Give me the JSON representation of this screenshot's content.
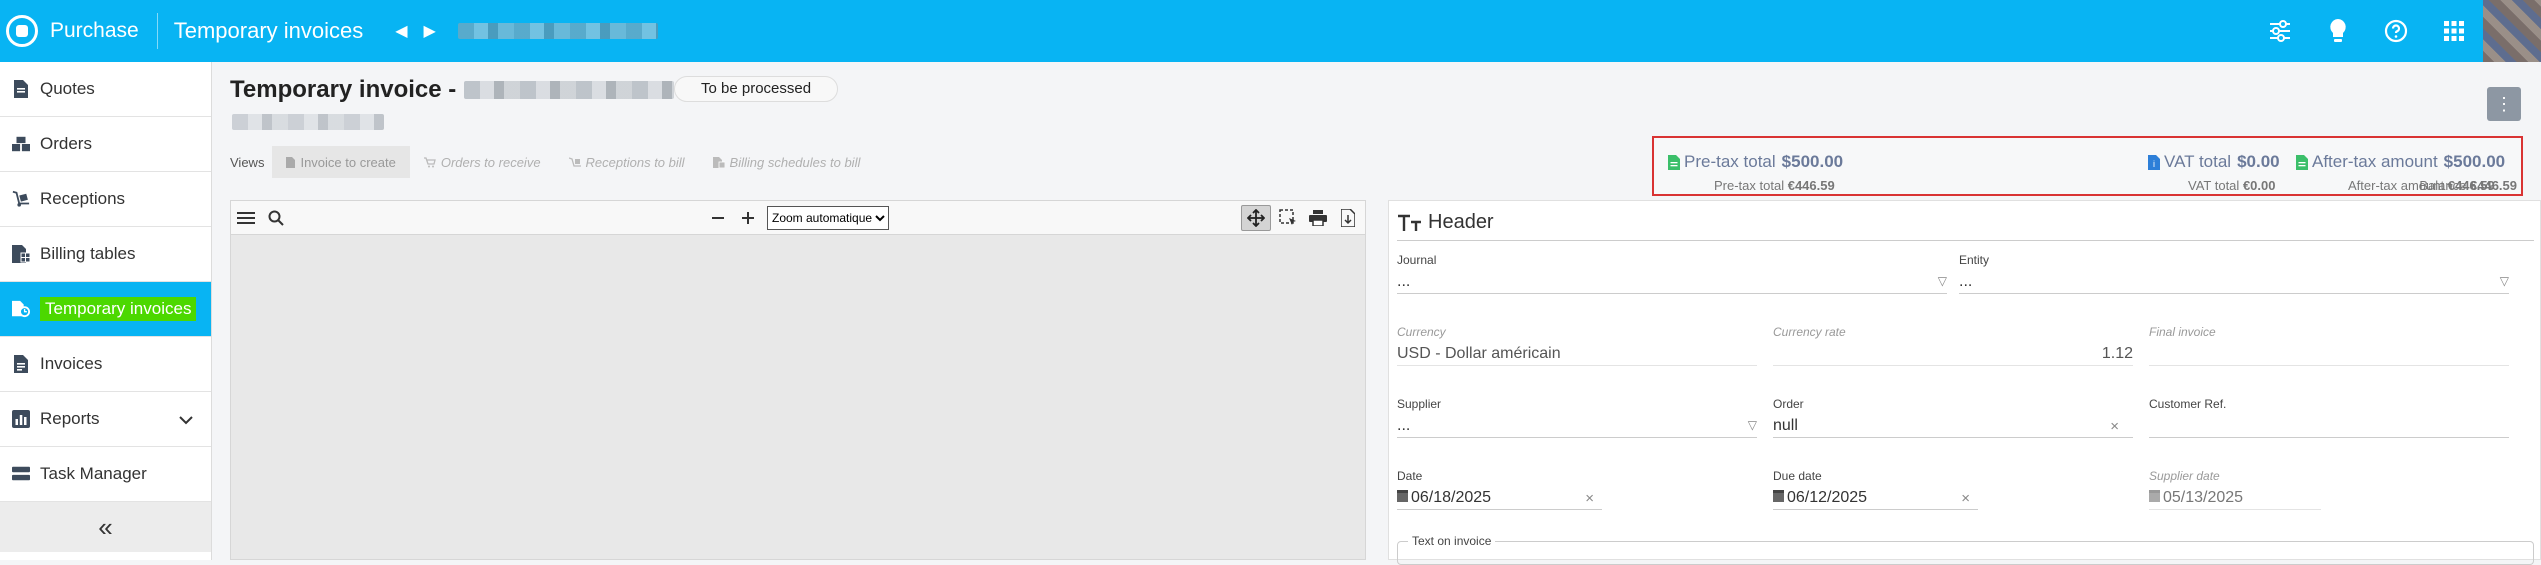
{
  "app": {
    "title": "Purchase",
    "module": "Temporary invoices"
  },
  "sidebar": {
    "items": [
      {
        "label": "Quotes",
        "icon": "quote-doc-icon"
      },
      {
        "label": "Orders",
        "icon": "orders-boxes-icon"
      },
      {
        "label": "Receptions",
        "icon": "dolly-icon"
      },
      {
        "label": "Billing tables",
        "icon": "billing-table-icon"
      },
      {
        "label": "Temporary invoices",
        "icon": "temp-invoice-icon",
        "active": true
      },
      {
        "label": "Invoices",
        "icon": "invoice-icon"
      },
      {
        "label": "Reports",
        "icon": "report-icon"
      },
      {
        "label": "Task Manager",
        "icon": "task-manager-icon"
      }
    ],
    "collapse": "«"
  },
  "page": {
    "title": "Temporary invoice -",
    "status": "To be processed",
    "views_label": "Views",
    "views": [
      "Invoice to create",
      "Orders to receive",
      "Receptions to bill",
      "Billing schedules to bill"
    ]
  },
  "totals": {
    "pretax_label": "Pre-tax total",
    "pretax_value": "$500.00",
    "pretax_sub_label": "Pre-tax total",
    "pretax_sub_value": "€446.59",
    "vat_label": "VAT total",
    "vat_value": "$0.00",
    "vat_sub_label": "VAT total",
    "vat_sub_value": "€0.00",
    "aftertax_label": "After-tax amount",
    "aftertax_value": "$500.00",
    "aftertax_sub_label": "After-tax amount",
    "aftertax_sub_value": "€446.59",
    "balance_label": "Balance",
    "balance_value": "€446.59"
  },
  "viewer": {
    "zoom": "Zoom automatique"
  },
  "form": {
    "header_title": "Header",
    "journal": {
      "label": "Journal",
      "value": "..."
    },
    "entity": {
      "label": "Entity",
      "value": "..."
    },
    "currency": {
      "label": "Currency",
      "value": "USD - Dollar américain"
    },
    "currency_rate": {
      "label": "Currency rate",
      "value": "1.12"
    },
    "final_invoice": {
      "label": "Final invoice"
    },
    "supplier": {
      "label": "Supplier",
      "value": "..."
    },
    "order": {
      "label": "Order",
      "value": "null"
    },
    "customer_ref": {
      "label": "Customer Ref."
    },
    "date": {
      "label": "Date",
      "value": "06/18/2025"
    },
    "due_date": {
      "label": "Due date",
      "value": "06/12/2025"
    },
    "supplier_date": {
      "label": "Supplier date",
      "value": "05/13/2025"
    },
    "text_on_invoice": {
      "label": "Text on invoice"
    }
  },
  "colors": {
    "brand": "#08b4f3",
    "highlight": "#4cd800",
    "totals_border": "#d93333",
    "totals_text": "#6b7a9a"
  }
}
